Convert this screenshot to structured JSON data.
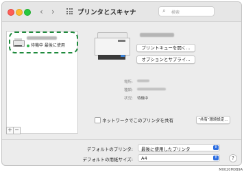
{
  "window": {
    "title": "プリンタとスキャナ",
    "nav_back": "‹",
    "nav_forward": "›",
    "search_placeholder": "検索"
  },
  "sidebar": {
    "selected_printer": {
      "status": "待機中 最後に使用"
    },
    "add_button": "+",
    "remove_button": "−"
  },
  "detail": {
    "buttons": {
      "open_queue": "プリントキューを開く...",
      "options": "オプションとサプライ..."
    },
    "info": {
      "location_label": "場所:",
      "kind_label": "種類:",
      "status_label": "状況:",
      "status_value": "待機中"
    },
    "share_checkbox_label": "ネットワークでこのプリンタを共有",
    "share_prefs_button": "\"共有\"環境設定..."
  },
  "defaults": {
    "printer_label": "デフォルトのプリンタ:",
    "printer_value": "最後に使用したプリンタ",
    "paper_label": "デフォルトの用紙サイズ:",
    "paper_value": "A4"
  },
  "help_label": "?",
  "figure_id": "M0020M0B9A",
  "colors": {
    "selection_outline": "#1e8a3c",
    "status_dot": "#2fb14a",
    "popup_accent": "#2f6fe0"
  }
}
